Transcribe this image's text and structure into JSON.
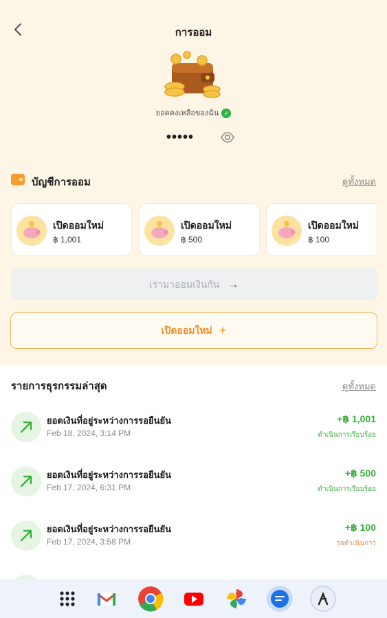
{
  "nav": {
    "title": "การออม"
  },
  "balance": {
    "label": "ยอดคงเหลือของฉัน",
    "masked": "•••••"
  },
  "accounts": {
    "title": "บัญชีการออม",
    "view_all": "ดูทั้งหมด",
    "items": [
      {
        "name": "เปิดออมใหม่",
        "amount": "฿ 1,001"
      },
      {
        "name": "เปิดออมใหม่",
        "amount": "฿ 500"
      },
      {
        "name": "เปิดออมใหม่",
        "amount": "฿ 100"
      }
    ]
  },
  "actions": {
    "together_label": "เรามาออมเงินกัน",
    "open_new_label": "เปิดออมใหม่"
  },
  "transactions": {
    "title": "รายการธุรกรรมล่าสุด",
    "view_all": "ดูทั้งหมด",
    "items": [
      {
        "title": "ยอดเงินที่อยู่ระหว่างการรอยืนยัน",
        "date": "Feb 18, 2024, 3:14 PM",
        "amount": "+฿ 1,001",
        "status": "ดำเนินการเรียบร้อย",
        "status_kind": "done"
      },
      {
        "title": "ยอดเงินที่อยู่ระหว่างการรอยืนยัน",
        "date": "Feb 17, 2024, 6:31 PM",
        "amount": "+฿ 500",
        "status": "ดำเนินการเรียบร้อย",
        "status_kind": "done"
      },
      {
        "title": "ยอดเงินที่อยู่ระหว่างการรอยืนยัน",
        "date": "Feb 17, 2024, 3:58 PM",
        "amount": "+฿ 100",
        "status": "รอดำเนินการ",
        "status_kind": "pending"
      }
    ]
  },
  "taskbar": {
    "apps": [
      "app-grid-icon",
      "gmail-icon",
      "chrome-icon",
      "youtube-icon",
      "photos-icon",
      "messages-icon",
      "assistant-icon"
    ]
  },
  "colors": {
    "accent": "#f08c1f",
    "background": "#fdf6e6",
    "positive": "#37b13b",
    "pending": "#f08c44"
  }
}
